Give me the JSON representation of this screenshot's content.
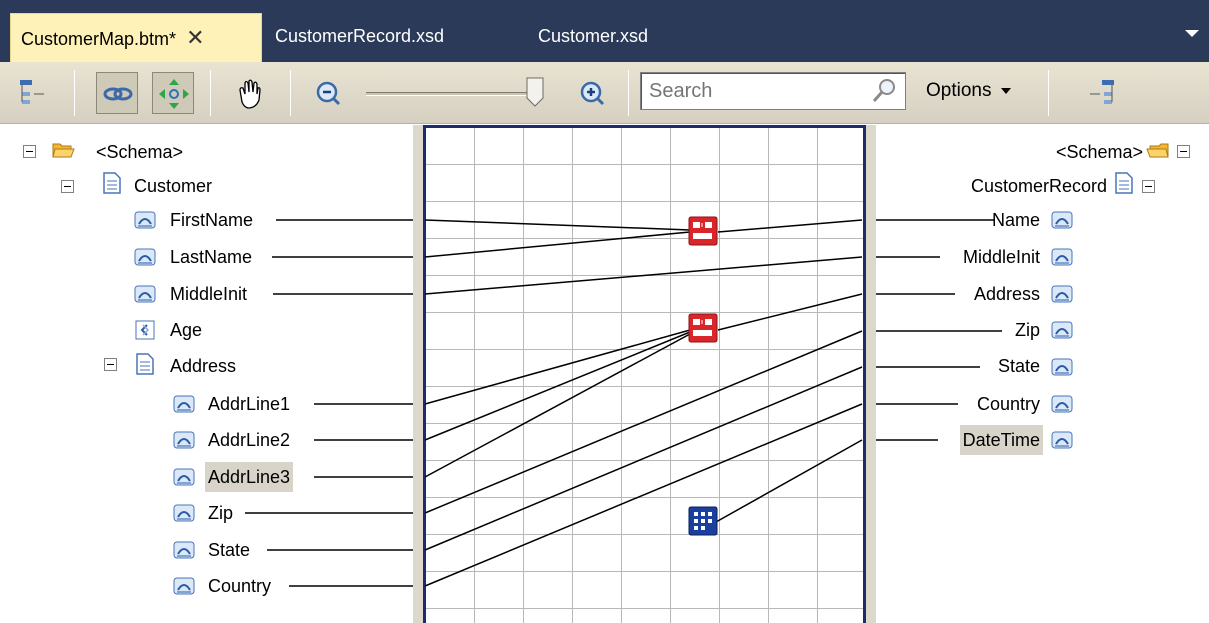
{
  "tabs": [
    {
      "label": "CustomerMap.btm*",
      "active": true,
      "closable": true
    },
    {
      "label": "CustomerRecord.xsd",
      "active": false,
      "closable": false
    },
    {
      "label": "Customer.xsd",
      "active": false,
      "closable": false
    }
  ],
  "toolbar": {
    "search_placeholder": "Search",
    "options_label": "Options",
    "zoom_level": 0.93
  },
  "source_tree": {
    "root": "<Schema>",
    "record": "Customer",
    "fields": [
      "FirstName",
      "LastName",
      "MiddleInit",
      "Age"
    ],
    "child_record": "Address",
    "child_fields": [
      "AddrLine1",
      "AddrLine2",
      "AddrLine3",
      "Zip",
      "State",
      "Country"
    ],
    "selected": "AddrLine3"
  },
  "destination_tree": {
    "root": "<Schema>",
    "record": "CustomerRecord",
    "fields": [
      "Name",
      "MiddleInit",
      "Address",
      "Zip",
      "State",
      "Country",
      "DateTime"
    ],
    "selected": "DateTime"
  },
  "functoids": [
    {
      "type": "string-concatenate",
      "icon": "string-concatenate-icon"
    },
    {
      "type": "string-concatenate",
      "icon": "string-concatenate-icon"
    },
    {
      "type": "date-time",
      "icon": "date-time-functoid-icon"
    }
  ],
  "colors": {
    "tabbar": "#2b3a58",
    "active_tab": "#fff2b8",
    "grid_border": "#1e2c6e",
    "functoid_red": "#d9262b",
    "functoid_blue": "#1b3f9e"
  }
}
